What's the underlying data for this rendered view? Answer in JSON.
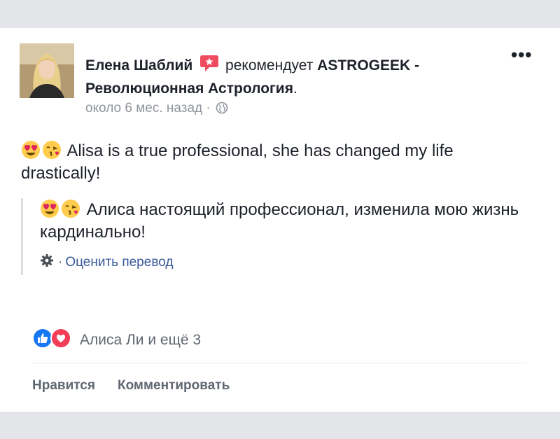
{
  "post": {
    "author": "Елена Шаблий",
    "recommends_text": "рекомендует",
    "page_name": "ASTROGEEK - Революционная Астрология",
    "page_period": ".",
    "timestamp": "около 6 мес. назад",
    "meta_separator": "·",
    "more_label": "•••",
    "body_text": "Alisa is a true professional, she has changed my life drastically!",
    "body_emojis": [
      "heart-eyes-emoji",
      "kissing-heart-emoji"
    ],
    "translation_text": "Алиса настоящий профессионал, изменила мою жизнь кардинально!",
    "rate_separator": "·",
    "rate_translation_label": "Оценить перевод"
  },
  "reactions": {
    "summary": "Алиса Ли и ещё 3",
    "icons": [
      "like-reaction-icon",
      "love-reaction-icon"
    ]
  },
  "actions": {
    "like_label": "Нравится",
    "comment_label": "Комментировать"
  },
  "colors": {
    "background": "#e4e5e9",
    "card": "#ffffff",
    "text": "#1d2129",
    "meta": "#90949c",
    "link": "#385898",
    "like_blue": "#1877f2",
    "love_red": "#f33e58",
    "recommend_red": "#ef4b5f"
  }
}
